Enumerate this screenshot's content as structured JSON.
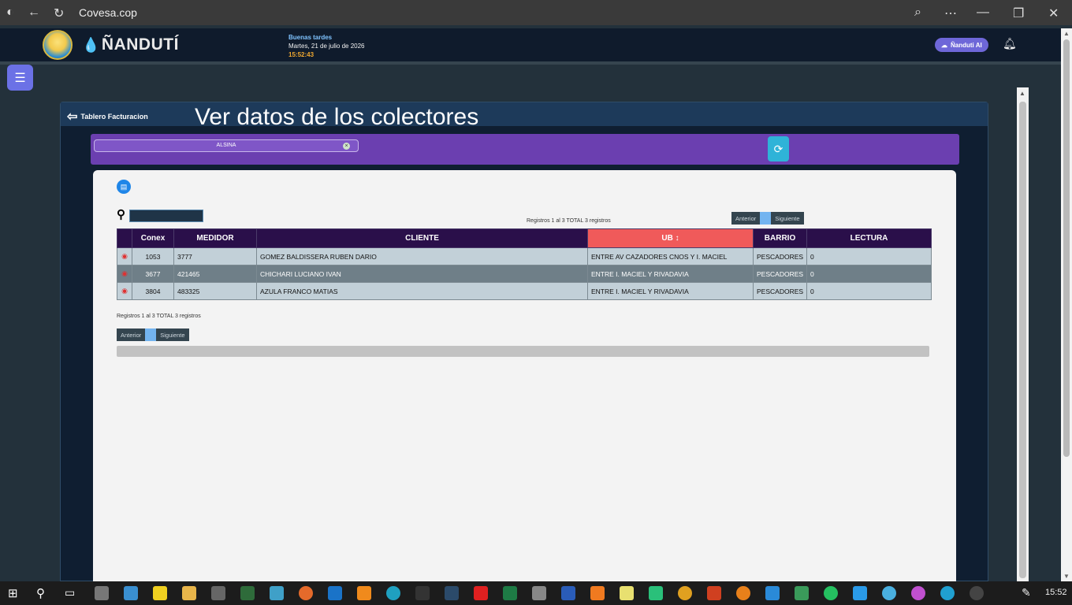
{
  "browser": {
    "title": "Covesa.cop"
  },
  "header": {
    "brand": "ÑANDUTÍ",
    "greeting": "Buenas tardes",
    "date": "Martes, 21 de julio de 2026",
    "time": "15:52:43",
    "ai_label": "Ñanduti AI"
  },
  "panel": {
    "back_label": "Tablero Facturacion",
    "title": "Ver datos de los colectores",
    "filter_value": "ALSINA"
  },
  "pagination": {
    "records_text": "Registros 1 al 3 TOTAL 3 registros",
    "prev": "Anterior",
    "next": "Siguiente"
  },
  "table": {
    "headers": [
      "Conex",
      "MEDIDOR",
      "CLIENTE",
      "UB",
      "BARRIO",
      "LECTURA"
    ],
    "sorted_column": "UB",
    "rows": [
      {
        "conex": "1053",
        "medidor": "3777",
        "cliente": "GOMEZ BALDISSERA RUBEN DARIO",
        "ub": "ENTRE AV CAZADORES CNOS Y I. MACIEL",
        "barrio": "PESCADORES",
        "lectura": "0"
      },
      {
        "conex": "3677",
        "medidor": "421465",
        "cliente": "CHICHARI LUCIANO IVAN",
        "ub": "ENTRE I. MACIEL Y RIVADAVIA",
        "barrio": "PESCADORES",
        "lectura": "0"
      },
      {
        "conex": "3804",
        "medidor": "483325",
        "cliente": "AZULA FRANCO MATIAS",
        "ub": "ENTRE I. MACIEL Y RIVADAVIA",
        "barrio": "PESCADORES",
        "lectura": "0"
      }
    ]
  },
  "taskbar": {
    "clock": "15:52"
  },
  "colors": {
    "header_bg": "#0f1b2c",
    "purple_bar": "#6b3fb0",
    "sorted_header": "#f05a5a",
    "table_header": "#2a0f4a",
    "accent": "#6b71e6"
  }
}
